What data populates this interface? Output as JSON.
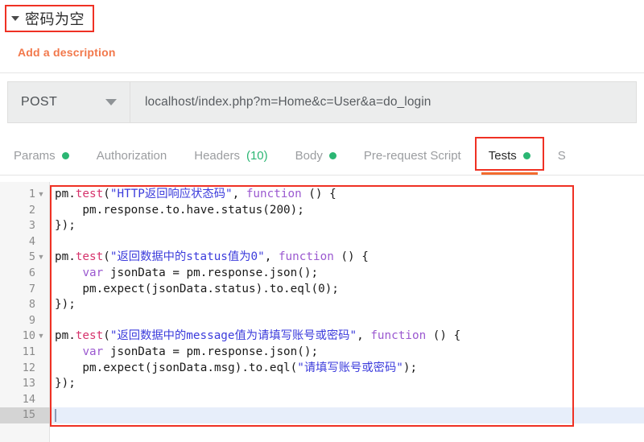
{
  "header": {
    "collapse_icon": "caret-down-icon",
    "title": "密码为空",
    "description_link": "Add a description"
  },
  "request_bar": {
    "method": "POST",
    "method_caret_icon": "chevron-down-icon",
    "url": "localhost/index.php?m=Home&c=User&a=do_login"
  },
  "tabs": [
    {
      "label": "Params",
      "dot": true,
      "count": "",
      "active": false,
      "highlighted": false
    },
    {
      "label": "Authorization",
      "dot": false,
      "count": "",
      "active": false,
      "highlighted": false
    },
    {
      "label": "Headers",
      "dot": false,
      "count": "(10)",
      "active": false,
      "highlighted": false
    },
    {
      "label": "Body",
      "dot": true,
      "count": "",
      "active": false,
      "highlighted": false
    },
    {
      "label": "Pre-request Script",
      "dot": false,
      "count": "",
      "active": false,
      "highlighted": false
    },
    {
      "label": "Tests",
      "dot": true,
      "count": "",
      "active": true,
      "highlighted": true
    },
    {
      "label": "S",
      "dot": false,
      "count": "",
      "active": false,
      "highlighted": false
    }
  ],
  "editor": {
    "active_line": 15,
    "total_lines": 15,
    "fold_lines": [
      1,
      5,
      10
    ],
    "lines": [
      {
        "n": 1,
        "tokens": [
          {
            "t": "pm.",
            "c": "plain"
          },
          {
            "t": "test",
            "c": "fn"
          },
          {
            "t": "(",
            "c": "plain"
          },
          {
            "t": "\"HTTP返回响应状态码\"",
            "c": "str"
          },
          {
            "t": ", ",
            "c": "plain"
          },
          {
            "t": "function",
            "c": "kw"
          },
          {
            "t": " () {",
            "c": "plain"
          }
        ]
      },
      {
        "n": 2,
        "tokens": [
          {
            "t": "    pm.response.to.have.status(200);",
            "c": "plain"
          }
        ]
      },
      {
        "n": 3,
        "tokens": [
          {
            "t": "});",
            "c": "plain"
          }
        ]
      },
      {
        "n": 4,
        "tokens": [
          {
            "t": "",
            "c": "plain"
          }
        ]
      },
      {
        "n": 5,
        "tokens": [
          {
            "t": "pm.",
            "c": "plain"
          },
          {
            "t": "test",
            "c": "fn"
          },
          {
            "t": "(",
            "c": "plain"
          },
          {
            "t": "\"返回数据中的status值为0\"",
            "c": "str"
          },
          {
            "t": ", ",
            "c": "plain"
          },
          {
            "t": "function",
            "c": "kw"
          },
          {
            "t": " () {",
            "c": "plain"
          }
        ]
      },
      {
        "n": 6,
        "tokens": [
          {
            "t": "    ",
            "c": "plain"
          },
          {
            "t": "var",
            "c": "kw"
          },
          {
            "t": " jsonData = pm.response.json();",
            "c": "plain"
          }
        ]
      },
      {
        "n": 7,
        "tokens": [
          {
            "t": "    pm.expect(jsonData.status).to.eql(0);",
            "c": "plain"
          }
        ]
      },
      {
        "n": 8,
        "tokens": [
          {
            "t": "});",
            "c": "plain"
          }
        ]
      },
      {
        "n": 9,
        "tokens": [
          {
            "t": "",
            "c": "plain"
          }
        ]
      },
      {
        "n": 10,
        "tokens": [
          {
            "t": "pm.",
            "c": "plain"
          },
          {
            "t": "test",
            "c": "fn"
          },
          {
            "t": "(",
            "c": "plain"
          },
          {
            "t": "\"返回数据中的message值为请填写账号或密码\"",
            "c": "str"
          },
          {
            "t": ", ",
            "c": "plain"
          },
          {
            "t": "function",
            "c": "kw"
          },
          {
            "t": " () {",
            "c": "plain"
          }
        ]
      },
      {
        "n": 11,
        "tokens": [
          {
            "t": "    ",
            "c": "plain"
          },
          {
            "t": "var",
            "c": "kw"
          },
          {
            "t": " jsonData = pm.response.json();",
            "c": "plain"
          }
        ]
      },
      {
        "n": 12,
        "tokens": [
          {
            "t": "    pm.expect(jsonData.msg).to.eql(",
            "c": "plain"
          },
          {
            "t": "\"请填写账号或密码\"",
            "c": "str"
          },
          {
            "t": ");",
            "c": "plain"
          }
        ]
      },
      {
        "n": 13,
        "tokens": [
          {
            "t": "});",
            "c": "plain"
          }
        ]
      },
      {
        "n": 14,
        "tokens": [
          {
            "t": "",
            "c": "plain"
          }
        ]
      },
      {
        "n": 15,
        "tokens": [
          {
            "t": "",
            "c": "plain"
          }
        ]
      }
    ]
  },
  "colors": {
    "annotation_red": "#ef3124",
    "accent_orange": "#f26b2e",
    "dot_green": "#2bb673",
    "description_orange": "#f2784b",
    "string_blue": "#3c3cdc",
    "function_pink": "#d6336c",
    "keyword_purple": "#9b59d0",
    "active_line_blue": "#e7eefa"
  }
}
